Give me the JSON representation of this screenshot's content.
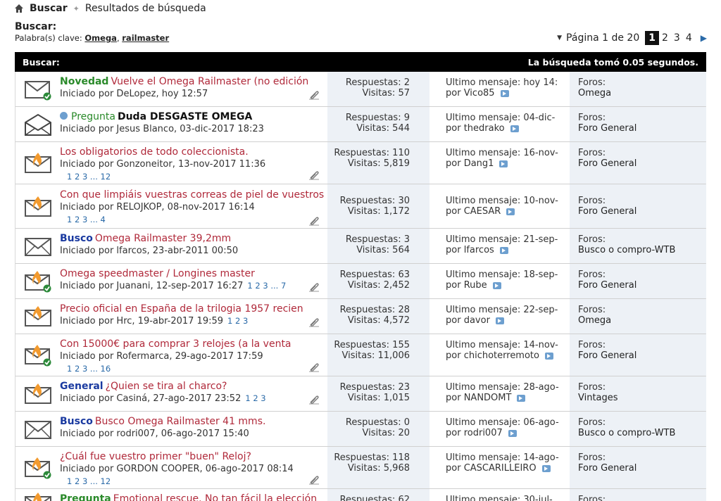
{
  "breadcrumb": {
    "root": "Buscar",
    "current": "Resultados de búsqueda"
  },
  "search": {
    "title": "Buscar:",
    "keywords_label": "Palabra(s) clave:",
    "keyword_1": "Omega",
    "keyword_sep": ",",
    "keyword_2": "railmaster"
  },
  "pager": {
    "label": "Página 1 de 20",
    "pages": [
      "1",
      "2",
      "3",
      "4"
    ]
  },
  "bar": {
    "left": "Buscar:",
    "right": "La búsqueda tomó 0.05 segundos."
  },
  "labels": {
    "replies": "Respuestas:",
    "views": "Visitas:",
    "last": "Último mensaje:",
    "by": "por",
    "forums": "Foros:"
  },
  "threads": [
    {
      "prefix": "Novedad",
      "title": "Vuelve el Omega Railmaster (no edición",
      "starter": "Iniciado por DeLopez, hoy 12:57",
      "replies": "2",
      "views": "57",
      "last_date": "hoy 14:",
      "last_user": "Vico85",
      "forum": "Omega",
      "icon": "envelope-check",
      "pages": ""
    },
    {
      "prefix": "Pregunta",
      "title": "Duda DESGASTE OMEGA",
      "starter": "Iniciado por Jesus Blanco, 03-dic-2017 18:23",
      "replies": "9",
      "views": "544",
      "last_date": "04-dic-",
      "last_user": "thedrako",
      "forum": "Foro General",
      "icon": "envelope-open",
      "pages": ""
    },
    {
      "prefix": "",
      "title": "Los obligatorios de todo coleccionista.",
      "starter": "Iniciado por Gonzoneitor, 13-nov-2017 11:36",
      "replies": "110",
      "views": "5,819",
      "last_date": "16-nov-",
      "last_user": "Dang1",
      "forum": "Foro General",
      "icon": "envelope-hot",
      "pages": "1  2  3 ... 12"
    },
    {
      "prefix": "",
      "title": "Con que limpiáis vuestras correas de piel de vuestros",
      "starter": "Iniciado por RELOJKOP, 08-nov-2017 16:14",
      "replies": "30",
      "views": "1,172",
      "last_date": "10-nov-",
      "last_user": "CAESAR",
      "forum": "Foro General",
      "icon": "envelope-hot",
      "pages": "1  2  3 ... 4"
    },
    {
      "prefix": "Busco",
      "title": "Omega Railmaster 39,2mm",
      "starter": "Iniciado por lfarcos, 23-abr-2011 00:50",
      "replies": "3",
      "views": "564",
      "last_date": "21-sep-",
      "last_user": "lfarcos",
      "forum": "Busco o compro-WTB",
      "icon": "envelope",
      "pages": ""
    },
    {
      "prefix": "",
      "title": "Omega speedmaster / Longines master",
      "starter": "Iniciado por Juanani, 12-sep-2017 16:27",
      "replies": "63",
      "views": "2,452",
      "last_date": "18-sep-",
      "last_user": "Rube",
      "forum": "Foro General",
      "icon": "envelope-hot-check",
      "pages": "1  2  3 ... 7"
    },
    {
      "prefix": "",
      "title": "Precio oficial en España de la trilogia 1957 recien",
      "starter": "Iniciado por Hrc, 19-abr-2017 19:59",
      "replies": "28",
      "views": "4,572",
      "last_date": "22-sep-",
      "last_user": "davor",
      "forum": "Omega",
      "icon": "envelope-hot",
      "pages": "1  2  3"
    },
    {
      "prefix": "",
      "title": "Con 15000€ para comprar 3 relojes (a la venta",
      "starter": "Iniciado por Rofermarca, 29-ago-2017 17:59",
      "replies": "155",
      "views": "11,006",
      "last_date": "14-nov-",
      "last_user": "chichoterremoto",
      "forum": "Foro General",
      "icon": "envelope-hot-check",
      "pages": "1  2  3 ... 16"
    },
    {
      "prefix": "General",
      "title": "¿Quien se tira al charco?",
      "starter": "Iniciado por Casiná, 27-ago-2017 23:52",
      "replies": "23",
      "views": "1,015",
      "last_date": "28-ago-",
      "last_user": "NANDOMT",
      "forum": "Vintages",
      "icon": "envelope-hot",
      "pages": "1  2  3"
    },
    {
      "prefix": "Busco",
      "title": "Busco Omega Railmaster 41 mms.",
      "starter": "Iniciado por rodri007, 06-ago-2017 15:40",
      "replies": "0",
      "views": "20",
      "last_date": "06-ago-",
      "last_user": "rodri007",
      "forum": "Busco o compro-WTB",
      "icon": "envelope",
      "pages": ""
    },
    {
      "prefix": "",
      "title": "¿Cuál fue vuestro primer \"buen\" Reloj?",
      "starter": "Iniciado por GORDON COOPER, 06-ago-2017 08:14",
      "replies": "118",
      "views": "5,968",
      "last_date": "14-ago-",
      "last_user": "CASCARILLEIRO",
      "forum": "Foro General",
      "icon": "envelope-hot-check",
      "pages": "1  2  3 ... 12"
    },
    {
      "prefix": "Pregunta",
      "title": "Emotional rescue. No tan fácil la elección",
      "starter": "",
      "replies": "62",
      "views": "",
      "last_date": "30-jul-",
      "last_user": "",
      "forum": "",
      "icon": "envelope-hot",
      "pages": ""
    }
  ]
}
